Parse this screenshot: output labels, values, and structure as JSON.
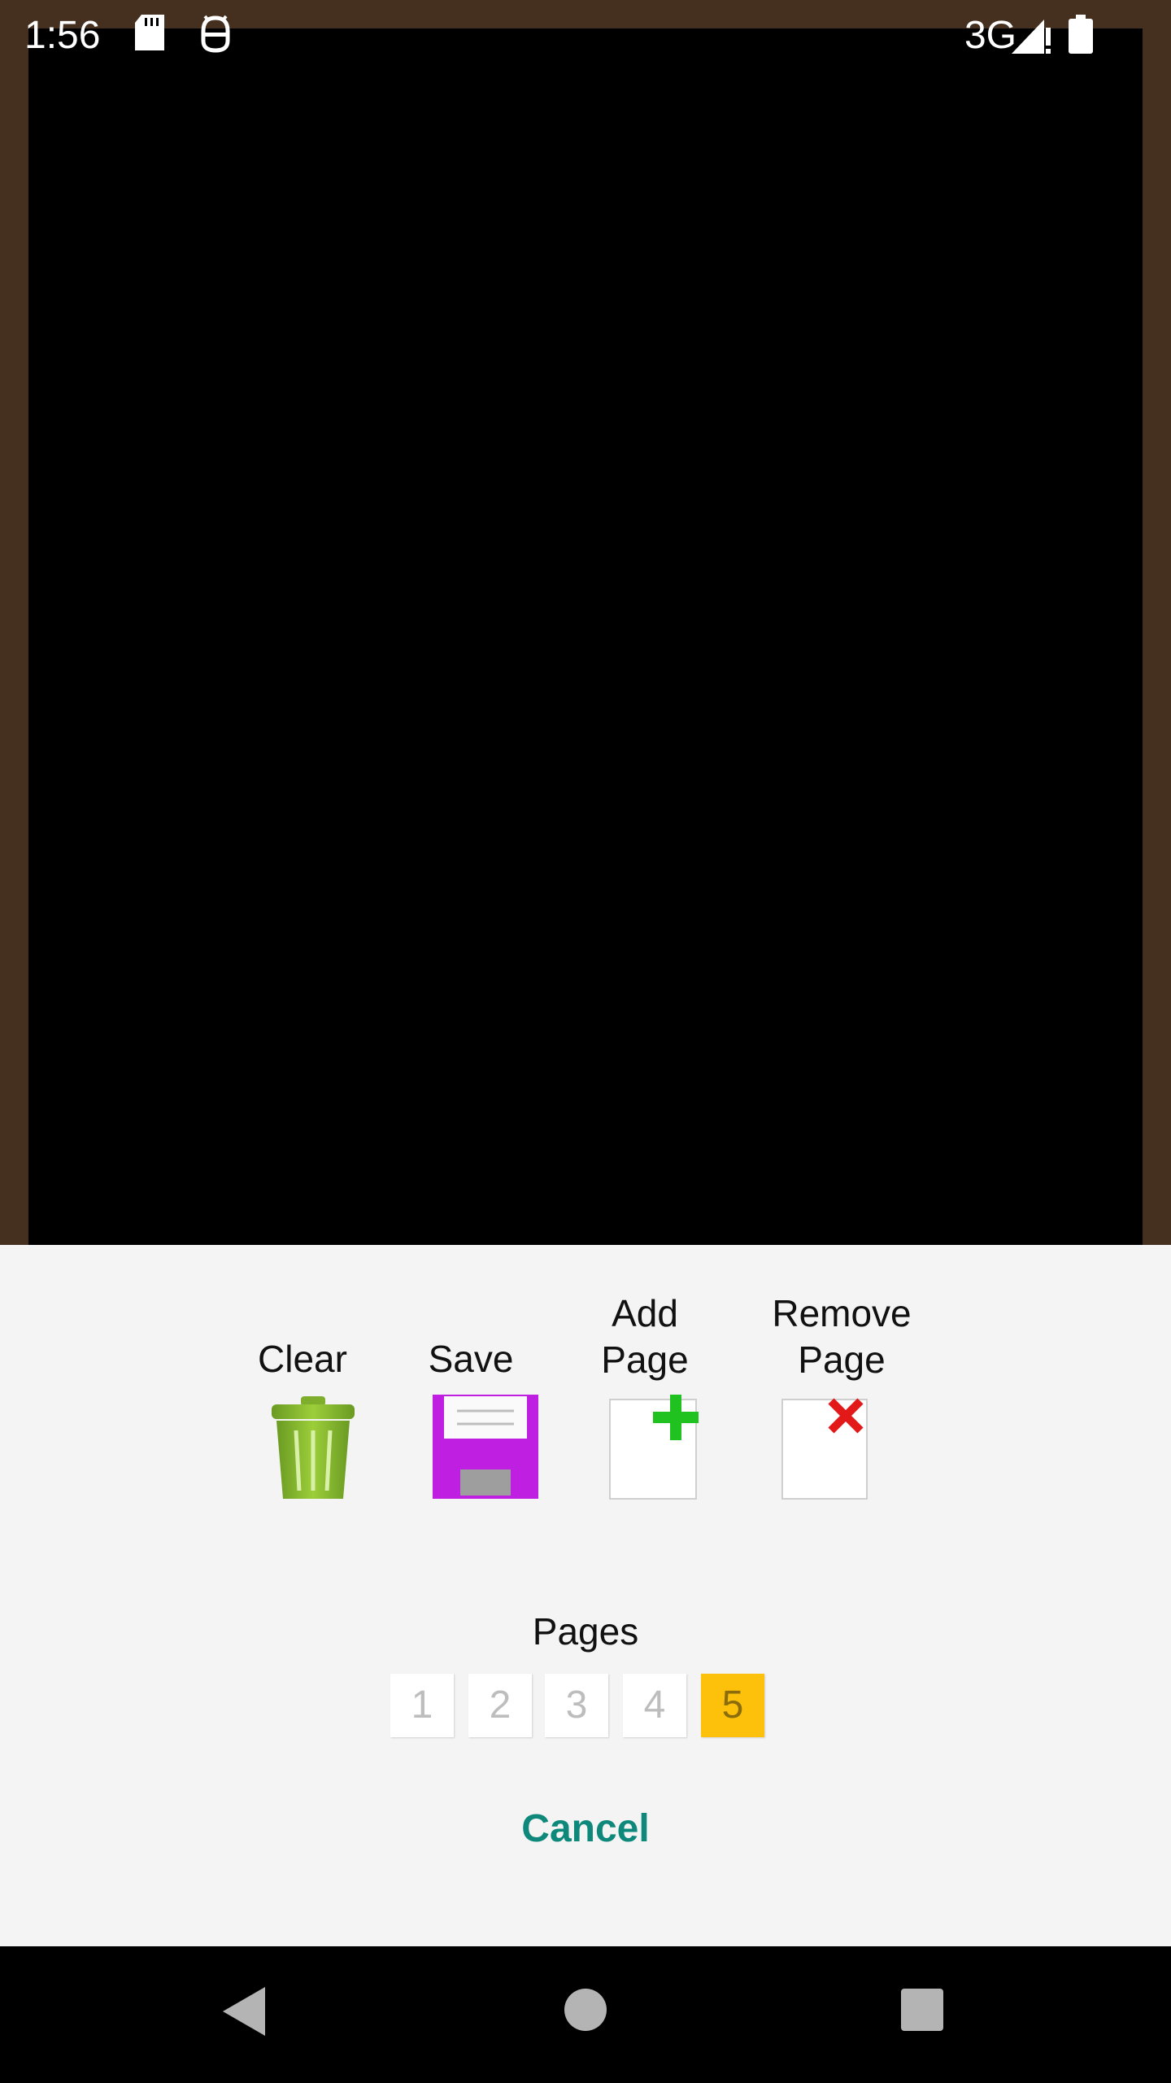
{
  "status_bar": {
    "time": "1:56",
    "network": "3G",
    "icons": [
      "sd-card-icon",
      "debug-icon",
      "signal-icon",
      "battery-icon"
    ]
  },
  "board": {
    "background": "#000000",
    "frame_color": "#452f1e"
  },
  "tools": {
    "clear": {
      "label": "Clear",
      "icon": "trash-icon"
    },
    "save": {
      "label": "Save",
      "icon": "floppy-disk-icon"
    },
    "add_page": {
      "label": "Add\nPage",
      "icon": "add-page-icon"
    },
    "remove_page": {
      "label": "Remove\nPage",
      "icon": "remove-page-icon"
    }
  },
  "pages": {
    "title": "Pages",
    "items": [
      "1",
      "2",
      "3",
      "4",
      "5"
    ],
    "selected": "5",
    "accent": "#fdc10c"
  },
  "cancel_label": "Cancel",
  "colors": {
    "cancel": "#0e887a",
    "sheet": "#f4f4f4"
  }
}
